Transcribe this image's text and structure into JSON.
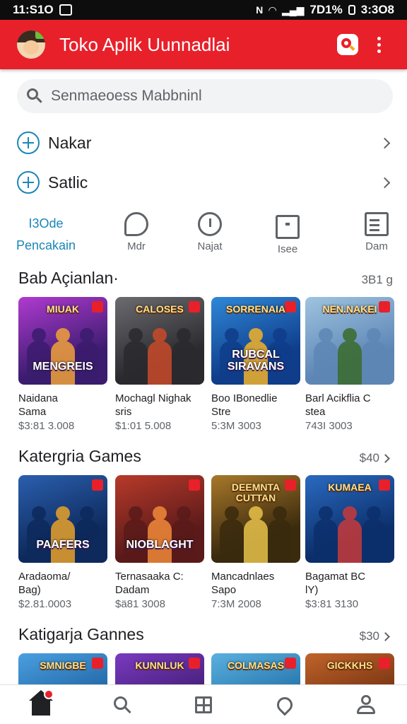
{
  "status_bar": {
    "time": "11:S1O",
    "indicators": "N",
    "battery": "7D1%",
    "clock_right": "3:3O8"
  },
  "app_bar": {
    "title": "Toko Aplik Uunnadlai",
    "logo_icon": "avatar-logo",
    "action_icons": [
      "search-badge-icon",
      "more-vert-icon"
    ]
  },
  "search": {
    "placeholder": "Senmaeoess Mabbninl"
  },
  "menu": [
    {
      "label": "Nakar",
      "icon": "globe-icon"
    },
    {
      "label": "Satlic",
      "icon": "globe-icon"
    }
  ],
  "categories": [
    {
      "line1": "I3Ode",
      "line2": "Pencakain",
      "icon": "",
      "active": true
    },
    {
      "line1": "",
      "line2": "Mdr",
      "icon": "chat-icon",
      "active": false
    },
    {
      "line1": "",
      "line2": "Najat",
      "icon": "clock-icon",
      "active": false
    },
    {
      "line1": "",
      "line2": "Isee",
      "icon": "tv-icon",
      "active": false
    },
    {
      "line1": "",
      "line2": "Dam",
      "icon": "list-icon",
      "active": false
    }
  ],
  "sections": [
    {
      "title": "Bab Açianlan·",
      "more": "3B1 g",
      "cards": [
        {
          "title": "Naidana",
          "subtitle": "Sama",
          "price": "$3:81 3.008",
          "art_top": "MIUAK",
          "art_bottom": "MENGREIS",
          "palette": [
            "#3b1c6e",
            "#b03ad1",
            "#f0a23a"
          ]
        },
        {
          "title": "Mochagl Nighak",
          "subtitle": "sris",
          "price": "$1:01 5.008",
          "art_top": "CALOSES",
          "art_bottom": "",
          "palette": [
            "#2a2a2e",
            "#6c6c70",
            "#c94a2a"
          ]
        },
        {
          "title": "Boo IBonedlie",
          "subtitle": "Stre",
          "price": "5:3M 3003",
          "art_top": "SORRENAIA",
          "art_bottom": "RUBCAL SIRAVANS",
          "palette": [
            "#0f3d8a",
            "#2f88d8",
            "#f2b32a"
          ]
        },
        {
          "title": "Barl Acikflia C",
          "subtitle": "stea",
          "price": "743I 3003",
          "art_top": "NEN.NAKEI",
          "art_bottom": "",
          "palette": [
            "#5d86b5",
            "#9fc3e0",
            "#3a6b2a"
          ]
        }
      ]
    },
    {
      "title": "Katergria Games",
      "more": "$40",
      "cards": [
        {
          "title": "Aradaoma/",
          "subtitle": "Bag)",
          "price": "$2.81.0003",
          "art_top": "",
          "art_bottom": "PAAFERS",
          "palette": [
            "#0e2a5c",
            "#2a5fae",
            "#e8a12a"
          ]
        },
        {
          "title": "Ternasaaka C:",
          "subtitle": "Dadam",
          "price": "$ä81 3008",
          "art_top": "",
          "art_bottom": "NIOBLAGHT",
          "palette": [
            "#5a1a1a",
            "#b83a2a",
            "#f08a3a"
          ]
        },
        {
          "title": "Mancadnlaes",
          "subtitle": "Sapo",
          "price": "7:3M 2008",
          "art_top": "DEEMNTA CUTTAN",
          "art_bottom": "",
          "palette": [
            "#3a2a0e",
            "#a8782a",
            "#e8c24a"
          ]
        },
        {
          "title": "Bagamat BC",
          "subtitle": "lY)",
          "price": "$3:81 3130",
          "art_top": "KUMAEA",
          "art_bottom": "",
          "palette": [
            "#0c2f6b",
            "#2a6ac0",
            "#c83a3a"
          ]
        }
      ]
    },
    {
      "title": "Katigarja Gannes",
      "more": "$30",
      "cards": [
        {
          "title": "",
          "subtitle": "",
          "price": "",
          "art_top": "SMNIGBE",
          "art_bottom": "",
          "palette": [
            "#1a5a9a",
            "#4aa0e0",
            "#f0b23a"
          ]
        },
        {
          "title": "",
          "subtitle": "",
          "price": "",
          "art_top": "KUNNLUK",
          "art_bottom": "",
          "palette": [
            "#3a1a6a",
            "#7a3ac0",
            "#f0c03a"
          ]
        },
        {
          "title": "",
          "subtitle": "",
          "price": "",
          "art_top": "COLMASAS",
          "art_bottom": "",
          "palette": [
            "#1a6aa0",
            "#5ab0e0",
            "#f0c04a"
          ]
        },
        {
          "title": "",
          "subtitle": "",
          "price": "",
          "art_top": "GICKKHS",
          "art_bottom": "",
          "palette": [
            "#6a2a0e",
            "#c0642a",
            "#f0c05a"
          ]
        }
      ]
    }
  ],
  "bottom_nav": [
    {
      "icon": "home-icon",
      "active": true,
      "badge": true
    },
    {
      "icon": "search-icon",
      "active": false,
      "badge": false
    },
    {
      "icon": "grid-icon",
      "active": false,
      "badge": false
    },
    {
      "icon": "location-icon",
      "active": false,
      "badge": false
    },
    {
      "icon": "profile-icon",
      "active": false,
      "badge": false
    }
  ],
  "colors": {
    "brand": "#e8202a",
    "accent": "#1a86b8",
    "status_bar": "#0d0d0d"
  }
}
